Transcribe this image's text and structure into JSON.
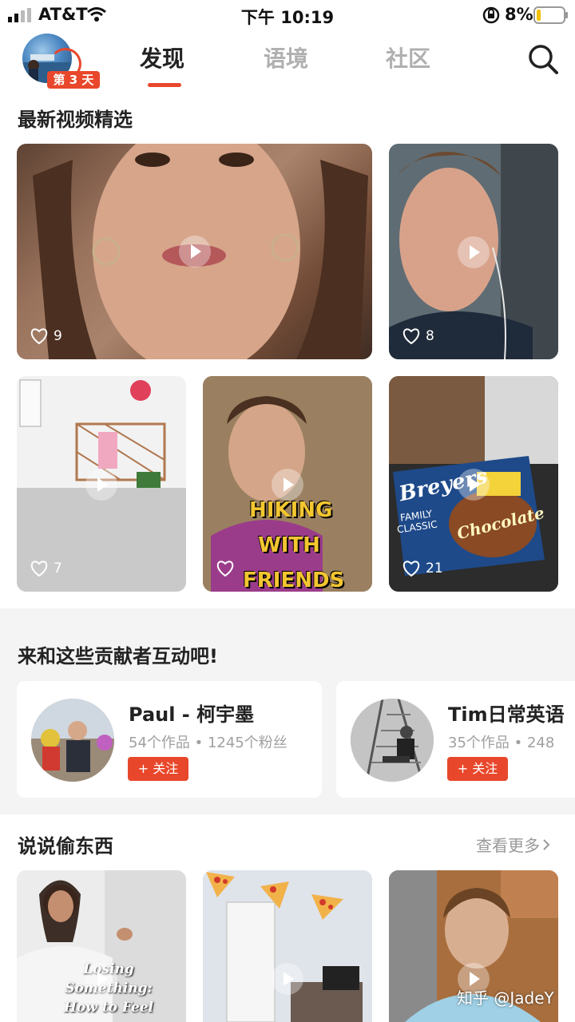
{
  "status_bar": {
    "carrier": "AT&T",
    "time": "下午 10:19",
    "battery": "8%"
  },
  "header": {
    "day_badge": "第 3 天",
    "tabs": [
      {
        "label": "发现",
        "active": true
      },
      {
        "label": "语境",
        "active": false
      },
      {
        "label": "社区",
        "active": false
      }
    ],
    "accent_color": "#e8472b"
  },
  "featured": {
    "title": "最新视频精选",
    "videos": [
      {
        "likes": "9"
      },
      {
        "likes": "8"
      },
      {
        "likes": "7"
      },
      {
        "likes": "",
        "overlay_text": [
          "HIKING",
          "WITH",
          "FRIENDS"
        ]
      },
      {
        "likes": "21",
        "product_text": [
          "Breyers",
          "FAMILY",
          "CLASSIC",
          "Chocolate"
        ]
      }
    ]
  },
  "contributors": {
    "title": "来和这些贡献者互动吧!",
    "items": [
      {
        "name": "Paul - 柯宇墨",
        "stats": "54个作品 • 1245个粉丝",
        "follow_label": "+ 关注"
      },
      {
        "name": "Tim日常英语",
        "stats": "35个作品 • 248",
        "follow_label": "+ 关注"
      }
    ]
  },
  "stealing": {
    "title": "说说偷东西",
    "more_label": "查看更多",
    "videos": [
      {
        "caption": [
          "Losing Something:",
          "How to Feel"
        ]
      },
      {
        "caption": []
      },
      {
        "caption": []
      }
    ]
  },
  "watermark": "知乎 @JadeY"
}
